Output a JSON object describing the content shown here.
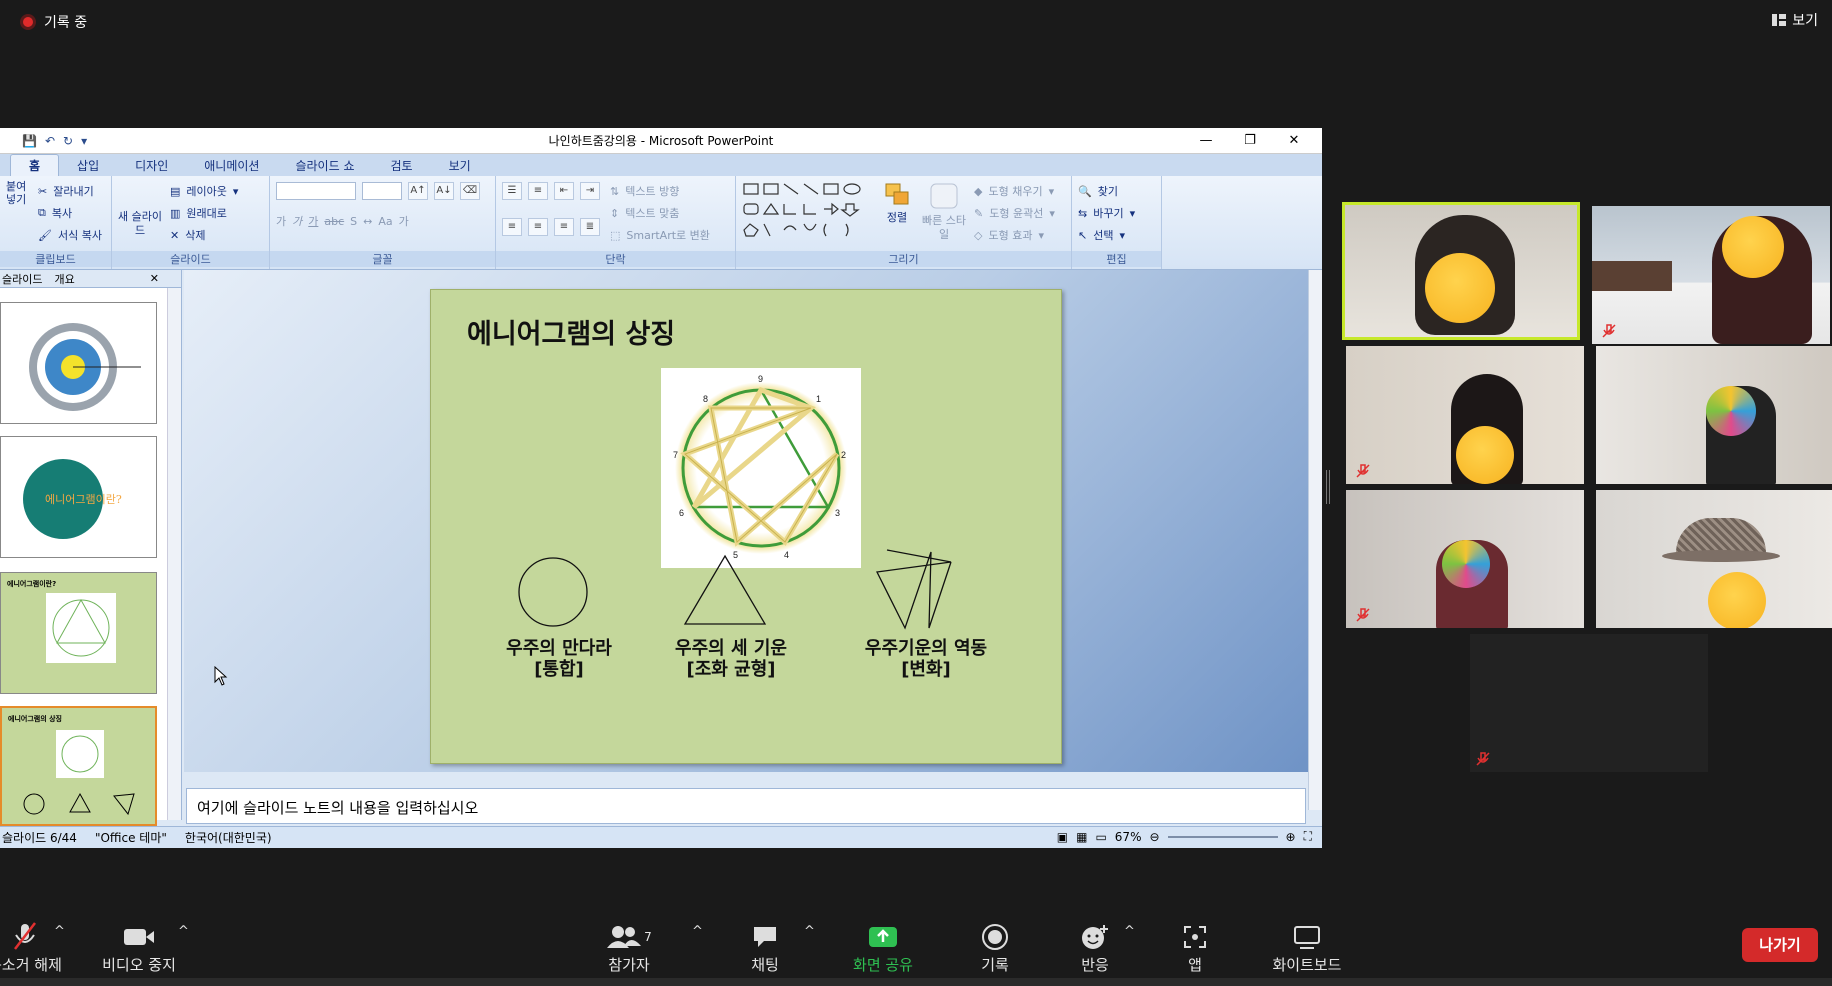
{
  "top": {
    "recording": "기록 중",
    "view": "보기"
  },
  "ppt": {
    "window_title": "나인하트줌강의용 - Microsoft PowerPoint",
    "tabs": [
      "홈",
      "삽입",
      "디자인",
      "애니메이션",
      "슬라이드 쇼",
      "검토",
      "보기"
    ],
    "ribbon": {
      "clipboard": {
        "paste": "붙여넣기",
        "cut": "잘라내기",
        "copy": "복사",
        "format_copy": "서식 복사",
        "name": "클립보드"
      },
      "slides": {
        "new": "새 슬라이드",
        "layout": "레이아웃",
        "reset": "원래대로",
        "delete": "삭제",
        "name": "슬라이드"
      },
      "font": {
        "name": "글꼴"
      },
      "paragraph": {
        "text_dir": "텍스트 방향",
        "align_text": "텍스트 맞춤",
        "smartart": "SmartArt로 변환",
        "name": "단락"
      },
      "drawing": {
        "arrange": "정렬",
        "quick_style": "빠른 스타일",
        "fill": "도형 채우기",
        "outline": "도형 윤곽선",
        "effects": "도형 효과",
        "name": "그리기"
      },
      "editing": {
        "find": "찾기",
        "replace": "바꾸기",
        "select": "선택",
        "name": "편집"
      }
    },
    "left_pane": {
      "tab_slides": "슬라이드",
      "tab_outline": "개요",
      "thumb2_text": "에니어그램이란?",
      "thumb3_title": "에니어그램이란?",
      "thumb4_title": "에니어그램의 상징"
    },
    "slide": {
      "title": "에니어그램의 상징",
      "symbols": [
        {
          "line1": "우주의 만다라",
          "line2": "[통합]"
        },
        {
          "line1": "우주의 세 기운",
          "line2": "[조화 균형]"
        },
        {
          "line1": "우주기운의 역동",
          "line2": "[변화]"
        }
      ]
    },
    "notes_placeholder": "여기에 슬라이드 노트의 내용을 입력하십시오",
    "status": {
      "slide": "슬라이드 6/44",
      "theme": "\"Office 테마\"",
      "lang": "한국어(대한민국)",
      "zoom": "67%"
    }
  },
  "toolbar": {
    "mute": "음소거 해제",
    "video": "비디오 중지",
    "participants": "참가자",
    "participants_count": "7",
    "chat": "채팅",
    "share": "화면 공유",
    "record": "기록",
    "reactions": "반응",
    "apps": "앱",
    "whiteboard": "화이트보드",
    "leave": "나가기"
  },
  "colors": {
    "share_green": "#2fc052",
    "leave_red": "#d42a2a",
    "slide_bg": "#c4d79b",
    "active_speaker": "#c6e82b"
  }
}
